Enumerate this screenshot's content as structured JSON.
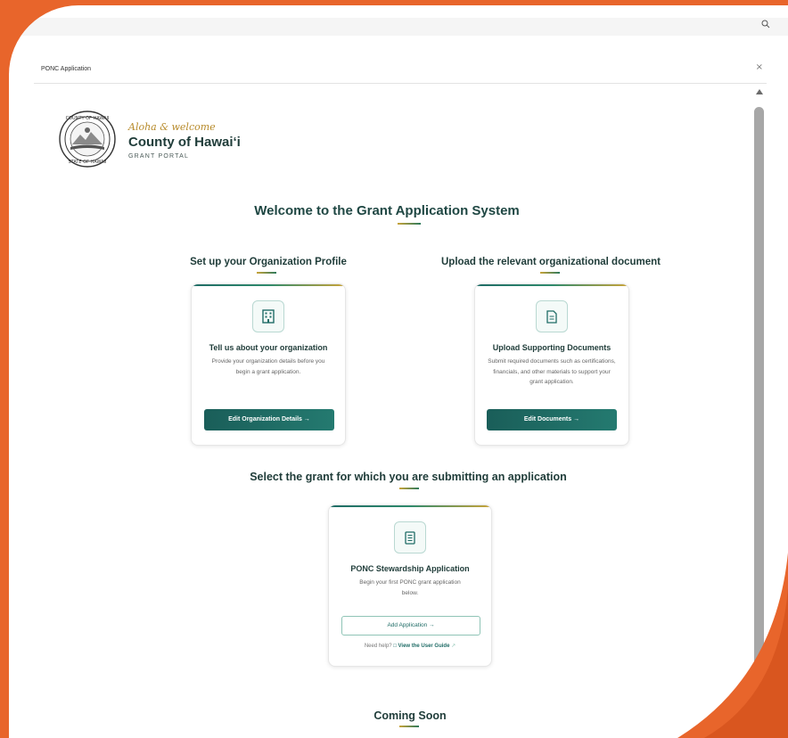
{
  "window": {
    "dialog_title": "PONC Application",
    "close_symbol": "×",
    "search_icon": "magnifier-icon"
  },
  "brand": {
    "tagline": "Aloha & welcome",
    "name": "County of Hawai‘i",
    "subtitle": "GRANT PORTAL",
    "seal_top_text": "COUNTY OF HAWAII",
    "seal_bottom_text": "STATE OF HAWAII"
  },
  "main": {
    "heading": "Welcome to the Grant Application System",
    "org_section": {
      "heading": "Set up your Organization Profile",
      "card_icon": "building-icon",
      "card_title": "Tell us about your organization",
      "card_desc": "Provide your organization details before you begin a grant application.",
      "button_label": "Edit Organization Details  →"
    },
    "docs_section": {
      "heading": "Upload the relevant organizational document",
      "card_icon": "document-icon",
      "card_title": "Upload Supporting Documents",
      "card_desc": "Submit required documents such as certifications, financials, and other materials to support your grant application.",
      "button_label": "Edit Documents  →"
    },
    "grant_section": {
      "heading": "Select the grant for which you are submitting an application",
      "card_icon": "list-document-icon",
      "card_title": "PONC Stewardship Application",
      "card_desc": "Begin your first PONC grant application below.",
      "button_label": "Add Application  →",
      "help_prefix": "Need help?",
      "help_link": "View the User Guide"
    },
    "coming_soon": "Coming Soon"
  },
  "colors": {
    "background_orange": "#e8652b",
    "primary_teal": "#1f6c66",
    "accent_gold": "#c9a43a"
  }
}
